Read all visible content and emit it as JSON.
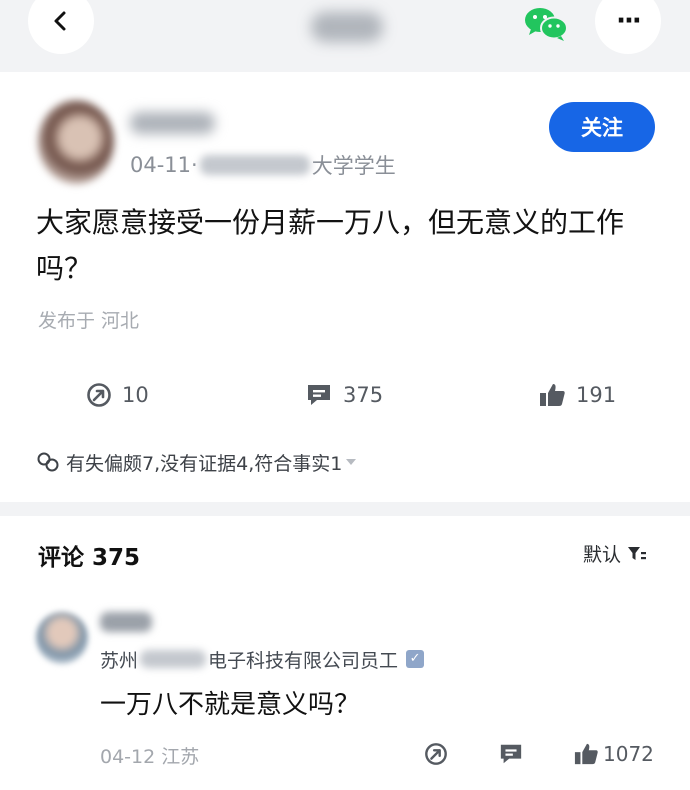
{
  "header": {
    "back_icon": "chevron-left-icon",
    "share_icon": "wechat-icon",
    "more_icon": "more-dots-icon",
    "more_label": "···"
  },
  "post": {
    "author_meta_date": "04-11·",
    "author_meta_title": "大学学生",
    "follow_label": "关注",
    "title": "大家愿意接受一份月薪一万八，但无意义的工作吗？",
    "location": "发布于 河北",
    "stats": {
      "share_count": "10",
      "comment_count": "375",
      "like_count": "191"
    },
    "evaluation": "有失偏颇7,没有证据4,符合事实1"
  },
  "comments": {
    "header_label": "评论 375",
    "sort_label": "默认",
    "items": [
      {
        "title_prefix": "苏州",
        "title_suffix": "电子科技有限公司员工",
        "verified_mark": "✓",
        "text": "一万八不就是意义吗？",
        "meta": "04-12 江苏",
        "like_count": "1072"
      }
    ]
  },
  "colors": {
    "accent": "#1766e6",
    "wechat": "#22c55e",
    "background_gray": "#f2f3f5"
  }
}
